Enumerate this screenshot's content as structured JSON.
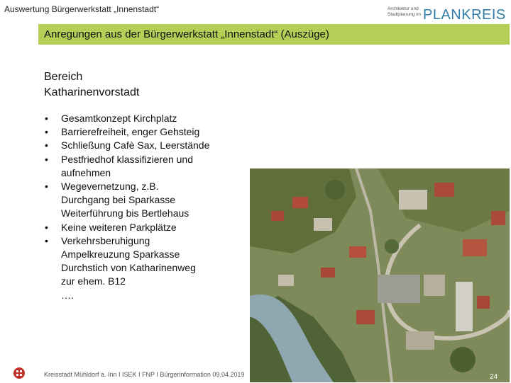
{
  "header": {
    "label": "Auswertung Bürgerwerkstatt „Innenstadt“",
    "logo_small_line1": "Architektur und",
    "logo_small_line2": "Stadtplanung im",
    "logo_brand": "PLANKREIS"
  },
  "title": "Anregungen aus der Bürgerwerkstatt „Innenstadt“ (Auszüge)",
  "section": {
    "line1": "Bereich",
    "line2": "Katharinenvorstadt"
  },
  "bullets": [
    {
      "lines": [
        "Gesamtkonzept Kirchplatz"
      ]
    },
    {
      "lines": [
        "Barrierefreiheit, enger Gehsteig"
      ]
    },
    {
      "lines": [
        "Schließung Cafè Sax, Leerstände"
      ]
    },
    {
      "lines": [
        "Pestfriedhof klassifizieren und",
        "aufnehmen"
      ]
    },
    {
      "lines": [
        "Wegevernetzung, z.B.",
        "Durchgang bei Sparkasse",
        "Weiterführung bis Bertlehaus"
      ]
    },
    {
      "lines": [
        "Keine weiteren Parkplätze"
      ]
    },
    {
      "lines": [
        "Verkehrsberuhigung",
        "Ampelkreuzung Sparkasse",
        "Durchstich von Katharinenweg",
        "zur ehem. B12",
        "…."
      ]
    }
  ],
  "footer": {
    "text": "Kreisstadt Mühldorf a. Inn  I  ISEK  I  FNP  I  Bürgerinformation 09.04.2019",
    "page_number": "24"
  },
  "colors": {
    "title_bar": "#b5cf56",
    "brand_blue": "#2f7da8"
  },
  "icons": {
    "footer": "town-crest-icon"
  }
}
